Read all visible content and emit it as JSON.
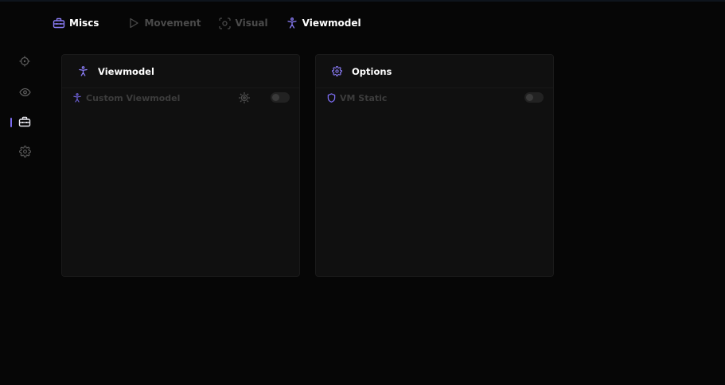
{
  "colors": {
    "accent": "#7b6cf0",
    "background": "#060606",
    "panel": "#101010",
    "dim_text": "#4a4a4a"
  },
  "top_tabs": [
    {
      "label": "Miscs",
      "icon": "toolbox-icon"
    },
    {
      "label": "Movement",
      "icon": "play-icon"
    },
    {
      "label": "Visual",
      "icon": "scan-icon"
    },
    {
      "label": "Viewmodel",
      "icon": "person-icon"
    }
  ],
  "sidebar": {
    "items": [
      {
        "name": "crosshair",
        "icon": "crosshair-icon"
      },
      {
        "name": "visuals",
        "icon": "eye-icon"
      },
      {
        "name": "miscs",
        "icon": "toolbox-icon",
        "active": true
      },
      {
        "name": "settings",
        "icon": "gear-icon"
      }
    ]
  },
  "panels": {
    "viewmodel": {
      "title": "Viewmodel",
      "rows": [
        {
          "label": "Custom Viewmodel",
          "enabled": false
        }
      ]
    },
    "options": {
      "title": "Options",
      "rows": [
        {
          "label": "VM Static",
          "enabled": false
        }
      ]
    }
  }
}
